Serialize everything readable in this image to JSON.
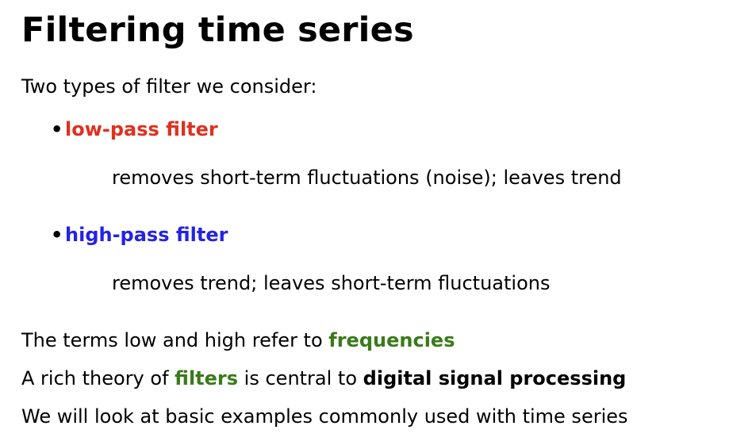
{
  "title": {
    "before": "Filtering time seri",
    "cursor_char": "e",
    "after": "s"
  },
  "intro": "Two types of filter we consider:",
  "bullets": [
    {
      "term": "low-pass filter",
      "term_color": "#e0301e",
      "description": "removes short-term fluctuations (noise); leaves trend"
    },
    {
      "term": "high-pass filter",
      "term_color": "#2323e6",
      "description": "removes trend; leaves short-term fluctuations"
    }
  ],
  "paragraphs": {
    "p1": {
      "text": "The terms low and high refer to ",
      "emph": "frequencies"
    },
    "p2": {
      "text1": "A rich theory of ",
      "emph": "filters",
      "text2": " is central to ",
      "bold": "digital signal processing"
    },
    "p3": {
      "text": "We will look at basic examples commonly used with time series"
    }
  },
  "colors": {
    "emphasis_green": "#3a7a1a",
    "cursor_highlight": "#b7c9dc"
  }
}
